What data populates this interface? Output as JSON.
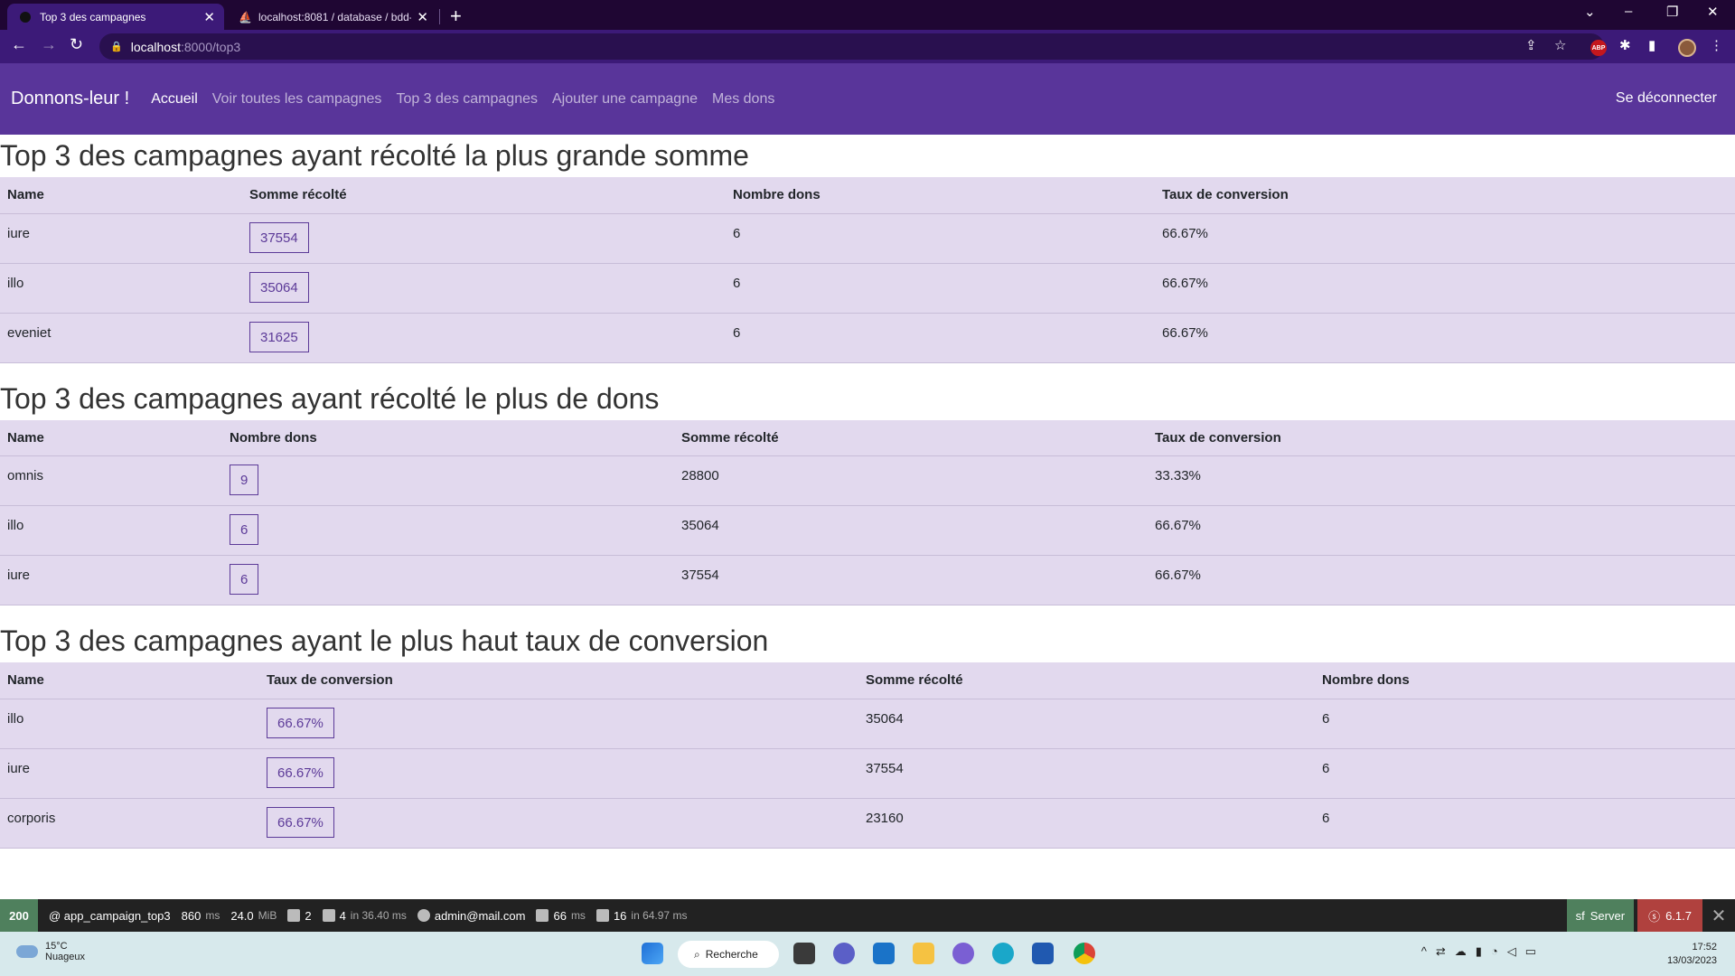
{
  "browser": {
    "tabs": [
      {
        "title": "Top 3 des campagnes",
        "active": true
      },
      {
        "title": "localhost:8081 / database / bdd-",
        "active": false
      }
    ],
    "url_host": "localhost",
    "url_path": ":8000/top3"
  },
  "navbar": {
    "brand": "Donnons-leur !",
    "links": [
      "Accueil",
      "Voir toutes les campagnes",
      "Top 3 des campagnes",
      "Ajouter une campagne",
      "Mes dons"
    ],
    "logout": "Se déconnecter"
  },
  "sections": [
    {
      "title": "Top 3 des campagnes ayant récolté la plus grande somme",
      "headers": [
        "Name",
        "Somme récolté",
        "Nombre dons",
        "Taux de conversion"
      ],
      "rows": [
        [
          "iure",
          "37554",
          "6",
          "66.67%"
        ],
        [
          "illo",
          "35064",
          "6",
          "66.67%"
        ],
        [
          "eveniet",
          "31625",
          "6",
          "66.67%"
        ]
      ]
    },
    {
      "title": "Top 3 des campagnes ayant récolté le plus de dons",
      "headers": [
        "Name",
        "Nombre dons",
        "Somme récolté",
        "Taux de conversion"
      ],
      "rows": [
        [
          "omnis",
          "9",
          "28800",
          "33.33%"
        ],
        [
          "illo",
          "6",
          "35064",
          "66.67%"
        ],
        [
          "iure",
          "6",
          "37554",
          "66.67%"
        ]
      ]
    },
    {
      "title": "Top 3 des campagnes ayant le plus haut taux de conversion",
      "headers": [
        "Name",
        "Taux de conversion",
        "Somme récolté",
        "Nombre dons"
      ],
      "rows": [
        [
          "illo",
          "66.67%",
          "35064",
          "6"
        ],
        [
          "iure",
          "66.67%",
          "37554",
          "6"
        ],
        [
          "corporis",
          "66.67%",
          "23160",
          "6"
        ]
      ]
    }
  ],
  "debug_toolbar": {
    "status": "200",
    "route": "@ app_campaign_top3",
    "time_value": "860",
    "time_unit": "ms",
    "memory_value": "24.0",
    "memory_unit": "MiB",
    "logs": "2",
    "cache": "4",
    "cache_detail": "in 36.40 ms",
    "user": "admin@mail.com",
    "twig_value": "66",
    "twig_unit": "ms",
    "db": "16",
    "db_detail": "in 64.97 ms",
    "server": "Server",
    "version": "6.1.7"
  },
  "taskbar": {
    "temperature": "15°C",
    "weather": "Nuageux",
    "search": "Recherche",
    "time": "17:52",
    "date": "13/03/2023"
  },
  "colors": {
    "navbar": "#59359a",
    "table_bg": "#e2d9ee",
    "highlight": "#5c3a98"
  }
}
